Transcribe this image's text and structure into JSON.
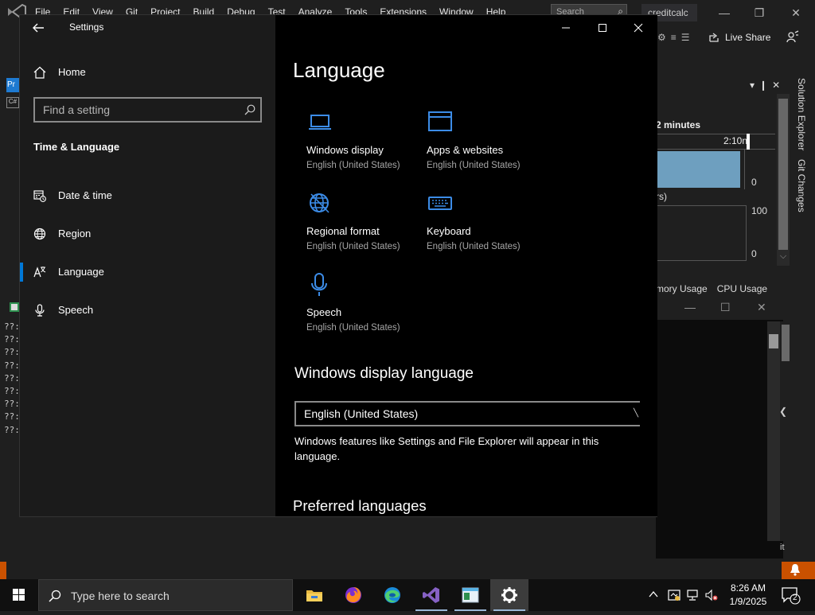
{
  "vs": {
    "menus": [
      "File",
      "Edit",
      "View",
      "Git",
      "Project",
      "Build",
      "Debug",
      "Test",
      "Analyze",
      "Tools",
      "Extensions",
      "Window",
      "Help"
    ],
    "search_placeholder": "Search",
    "project_name": "creditcalc",
    "live_share": "Live Share",
    "pr_tab": "Pr",
    "cs_tab": "C#",
    "console_lines": [
      "??:",
      "??:",
      "??:",
      "??:",
      "??:",
      "??:",
      "??:",
      "??:",
      "??:"
    ],
    "diag_minutes": "2 minutes",
    "diag_timeline_label": "2:10n",
    "diag_chart1_min": "0",
    "diag_rs_label": "rs)",
    "diag_chart2_max": "100",
    "diag_chart2_min": "0",
    "diag_tabs": [
      "mory Usage",
      "CPU Usage"
    ],
    "side_tabs": [
      "Solution Explorer",
      "Git Changes"
    ],
    "status_fragment": "it"
  },
  "settings": {
    "window_title": "Settings",
    "home_label": "Home",
    "search_placeholder": "Find a setting",
    "section_heading": "Time & Language",
    "nav_items": [
      {
        "label": "Date & time",
        "icon": "calendar-clock-icon",
        "active": false
      },
      {
        "label": "Region",
        "icon": "globe-icon",
        "active": false
      },
      {
        "label": "Language",
        "icon": "language-icon",
        "active": true
      },
      {
        "label": "Speech",
        "icon": "microphone-icon",
        "active": false
      }
    ],
    "page_title": "Language",
    "tiles": [
      {
        "title": "Windows display",
        "subtitle": "English (United States)",
        "icon": "laptop-icon"
      },
      {
        "title": "Apps & websites",
        "subtitle": "English (United States)",
        "icon": "browser-window-icon"
      },
      {
        "title": "Regional format",
        "subtitle": "English (United States)",
        "icon": "globe-icon"
      },
      {
        "title": "Keyboard",
        "subtitle": "English (United States)",
        "icon": "keyboard-icon"
      },
      {
        "title": "Speech",
        "subtitle": "English (United States)",
        "icon": "microphone-icon"
      }
    ],
    "display_language_heading": "Windows display language",
    "display_language_value": "English (United States)",
    "display_language_desc": "Windows features like Settings and File Explorer will appear in this language.",
    "preferred_languages_heading": "Preferred languages",
    "accent_color": "#3c8ce7"
  },
  "taskbar": {
    "search_placeholder": "Type here to search",
    "apps": [
      "file-explorer-icon",
      "firefox-icon",
      "edge-icon",
      "visual-studio-icon",
      "notepad-icon",
      "settings-gear-icon"
    ],
    "time": "8:26 AM",
    "date": "1/9/2025",
    "notification_count": "2"
  }
}
